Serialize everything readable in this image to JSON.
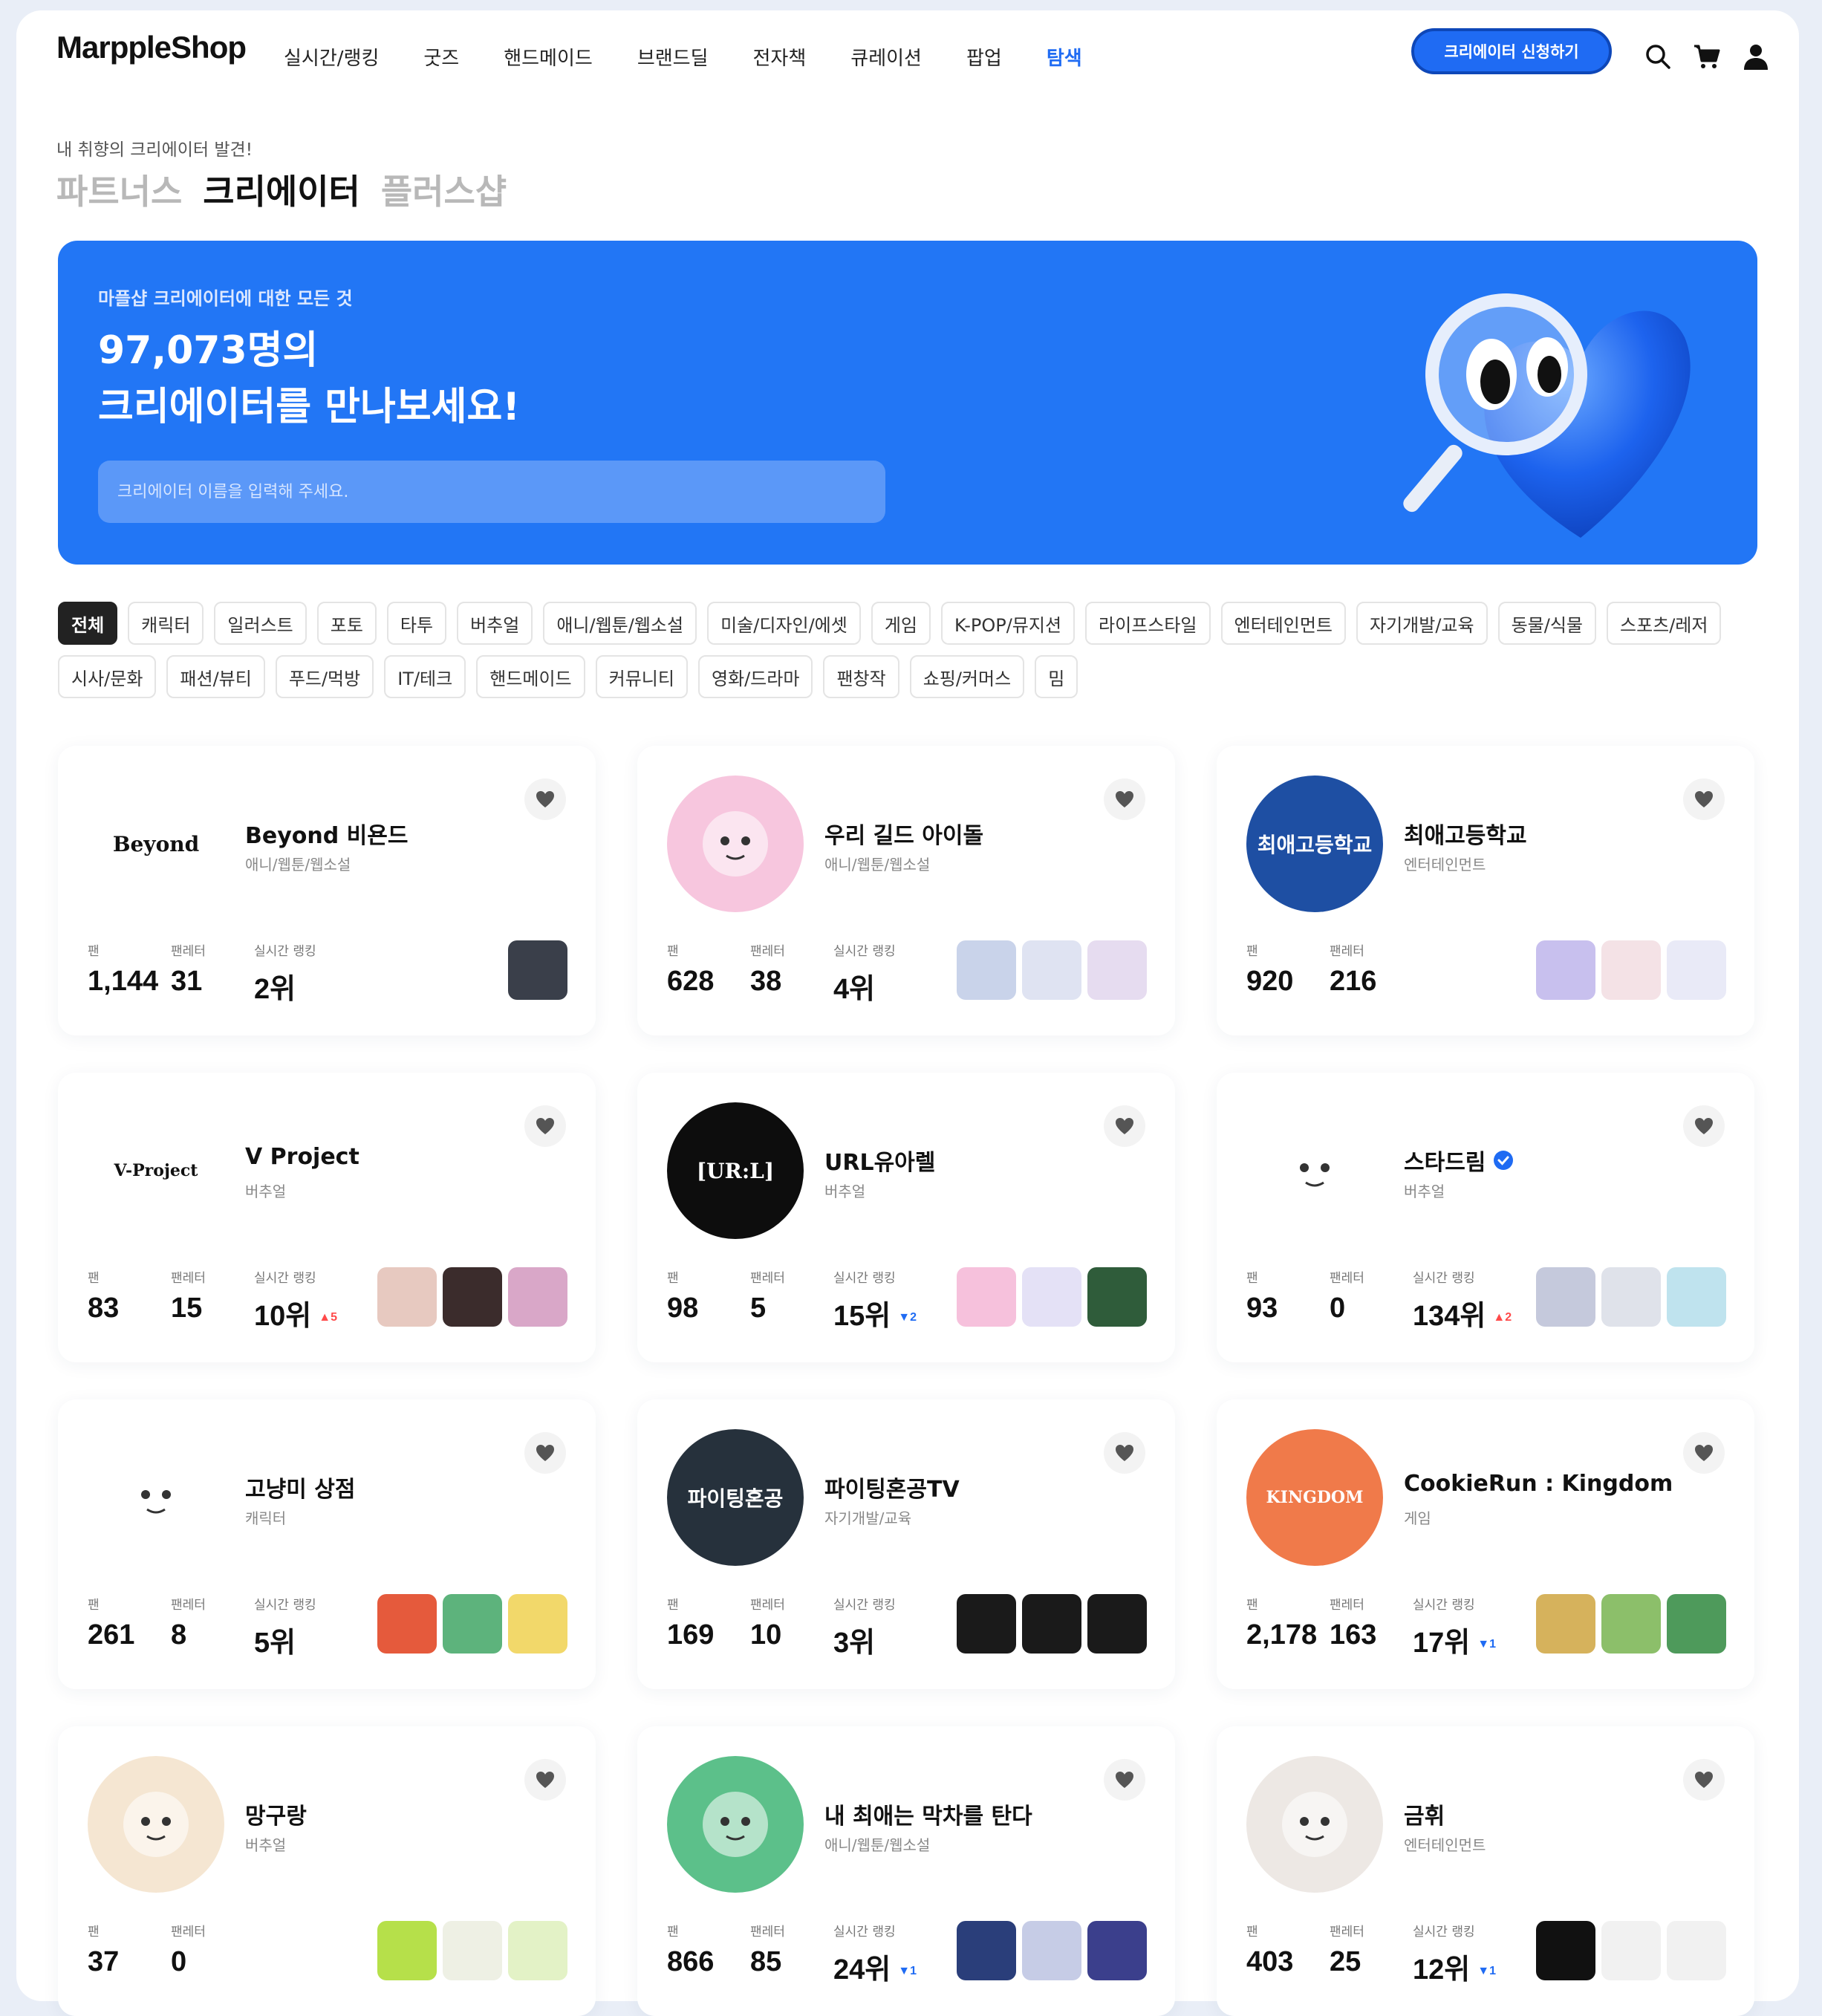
{
  "header": {
    "logo": "MarppleShop",
    "nav": [
      "실시간/랭킹",
      "굿즈",
      "핸드메이드",
      "브랜드딜",
      "전자책",
      "큐레이션",
      "팝업",
      "탐색"
    ],
    "active_nav": "탐색",
    "apply_button": "크리에이터 신청하기",
    "icons": [
      "search-icon",
      "cart-icon",
      "user-icon"
    ]
  },
  "intro": {
    "eyebrow": "내 취향의 크리에이터 발견!",
    "tabs": [
      "파트너스",
      "크리에이터",
      "플러스샵"
    ],
    "active_tab": "크리에이터"
  },
  "hero": {
    "subtitle": "마플샵 크리에이터에 대한 모든 것",
    "title_line1": "97,073명의",
    "title_line2": "크리에이터를 만나보세요!",
    "search_placeholder": "크리에이터 이름을 입력해 주세요.",
    "art": "heart-magnifier-illustration"
  },
  "categories": [
    "전체",
    "캐릭터",
    "일러스트",
    "포토",
    "타투",
    "버추얼",
    "애니/웹툰/웹소설",
    "미술/디자인/에셋",
    "게임",
    "K-POP/뮤지션",
    "라이프스타일",
    "엔터테인먼트",
    "자기개발/교육",
    "동물/식물",
    "스포츠/레저",
    "시사/문화",
    "패션/뷰티",
    "푸드/먹방",
    "IT/테크",
    "핸드메이드",
    "커뮤니티",
    "영화/드라마",
    "팬창작",
    "쇼핑/커머스",
    "밈"
  ],
  "active_category": "전체",
  "stat_labels": {
    "fans": "팬",
    "items": "팬레터",
    "rank": "실시간 랭킹"
  },
  "creators": [
    {
      "name": "Beyond 비욘드",
      "category": "애니/웹툰/웹소설",
      "fans": "1,144",
      "letters": "31",
      "rank": "2위",
      "delta": "",
      "delta_dir": "",
      "avatar_text": "Beyond",
      "avatar_bg": "#ffffff",
      "verified": false,
      "thumbs": [
        "#3a3f4a"
      ]
    },
    {
      "name": "우리 길드 아이돌",
      "category": "애니/웹툰/웹소설",
      "fans": "628",
      "letters": "38",
      "rank": "4위",
      "delta": "",
      "delta_dir": "",
      "avatar_text": "",
      "avatar_bg": "#f7c6de",
      "verified": false,
      "thumbs": [
        "#c9d3ea",
        "#dfe3f2",
        "#e6dcf0"
      ]
    },
    {
      "name": "최애고등학교",
      "category": "엔터테인먼트",
      "fans": "920",
      "letters": "216",
      "rank": "",
      "delta": "",
      "delta_dir": "",
      "avatar_text": "최애고등학교",
      "avatar_bg": "#1e4fa3",
      "verified": false,
      "thumbs": [
        "#c8c0ee",
        "#f4e2e6",
        "#e9eaf7"
      ]
    },
    {
      "name": "V Project",
      "category": "버추얼",
      "fans": "83",
      "letters": "15",
      "rank": "10위",
      "delta": "▲5",
      "delta_dir": "up",
      "avatar_text": "V-Project",
      "avatar_bg": "#ffffff",
      "verified": false,
      "thumbs": [
        "#e7c9c0",
        "#3b2c2c",
        "#d9a7c8"
      ]
    },
    {
      "name": "URL유아렐",
      "category": "버추얼",
      "fans": "98",
      "letters": "5",
      "rank": "15위",
      "delta": "▼2",
      "delta_dir": "down",
      "avatar_text": "[UR:L]",
      "avatar_bg": "#0d0d0d",
      "verified": false,
      "thumbs": [
        "#f6c1dc",
        "#e4e1f6",
        "#2f5c3a"
      ]
    },
    {
      "name": "스타드림",
      "category": "버추얼",
      "fans": "93",
      "letters": "0",
      "rank": "134위",
      "delta": "▲2",
      "delta_dir": "up",
      "avatar_text": "",
      "avatar_bg": "#ffffff",
      "verified": true,
      "thumbs": [
        "#c5c9dc",
        "#dfe2ea",
        "#bfe3ee"
      ]
    },
    {
      "name": "고냥미 상점",
      "category": "캐릭터",
      "fans": "261",
      "letters": "8",
      "rank": "5위",
      "delta": "",
      "delta_dir": "",
      "avatar_text": "",
      "avatar_bg": "#ffffff",
      "verified": false,
      "thumbs": [
        "#e55a3c",
        "#5db37c",
        "#f2d86a"
      ]
    },
    {
      "name": "파이팅혼공TV",
      "category": "자기개발/교육",
      "fans": "169",
      "letters": "10",
      "rank": "3위",
      "delta": "",
      "delta_dir": "",
      "avatar_text": "파이팅혼공",
      "avatar_bg": "#26313c",
      "verified": false,
      "thumbs": [
        "#1a1a1a",
        "#1a1a1a",
        "#1a1a1a"
      ]
    },
    {
      "name": "CookieRun : Kingdom",
      "category": "게임",
      "fans": "2,178",
      "letters": "163",
      "rank": "17위",
      "delta": "▼1",
      "delta_dir": "down",
      "avatar_text": "KINGDOM",
      "avatar_bg": "#f07a4a",
      "verified": false,
      "thumbs": [
        "#d6b25c",
        "#8cbf6a",
        "#4e9a5b"
      ]
    },
    {
      "name": "망구랑",
      "category": "버추얼",
      "fans": "37",
      "letters": "0",
      "rank": "",
      "delta": "",
      "delta_dir": "",
      "avatar_text": "",
      "avatar_bg": "#f5e6d2",
      "verified": false,
      "thumbs": [
        "#b6e04a",
        "#eef0e4",
        "#e3f2c6"
      ]
    },
    {
      "name": "내 최애는 막차를 탄다",
      "category": "애니/웹툰/웹소설",
      "fans": "866",
      "letters": "85",
      "rank": "24위",
      "delta": "▼1",
      "delta_dir": "down",
      "avatar_text": "",
      "avatar_bg": "#5cc08a",
      "verified": false,
      "thumbs": [
        "#2a3e7a",
        "#c6cce6",
        "#3b3f8c"
      ]
    },
    {
      "name": "금휘",
      "category": "엔터테인먼트",
      "fans": "403",
      "letters": "25",
      "rank": "12위",
      "delta": "▼1",
      "delta_dir": "down",
      "avatar_text": "",
      "avatar_bg": "#ede8e4",
      "verified": false,
      "thumbs": [
        "#111111",
        "#f1f1f1",
        "#f1f1f1"
      ]
    }
  ]
}
